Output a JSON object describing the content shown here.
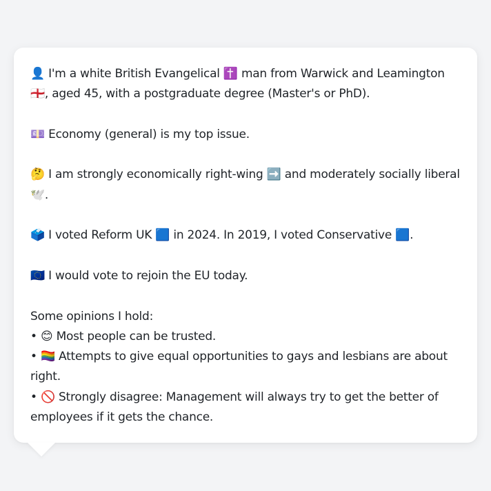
{
  "persona": {
    "intro": {
      "emoji_person": "👤",
      "text_before_religion": "I'm a white British Evangelical",
      "emoji_cross": "✝️",
      "text_before_place": "man from Warwick and Leamington",
      "emoji_flag": "🏴󠁧󠁢󠁥󠁮󠁧󠁿",
      "text_after_place": ", aged 45, with a postgraduate degree (Master's or PhD)."
    },
    "issue": {
      "emoji": "💷",
      "text": "Economy (general) is my top issue."
    },
    "ideology": {
      "emoji_think": "🤔",
      "text_before": "I am strongly economically right-wing",
      "emoji_arrow": "➡️",
      "text_middle": "and moderately socially liberal",
      "emoji_dove": "🕊️",
      "text_end": "."
    },
    "vote": {
      "emoji_ballot": "🗳️",
      "text_2024_before": "I voted Reform UK",
      "emoji_reform": "🟦",
      "text_2024_after": "in 2024. In 2019, I voted Conservative",
      "emoji_con": "🟦",
      "text_end": "."
    },
    "eu": {
      "emoji": "🇪🇺",
      "text": "I would vote to rejoin the EU today."
    },
    "opinions": {
      "heading": "Some opinions I hold:",
      "bullet": "•",
      "items": [
        {
          "emoji": "😊",
          "text": "Most people can be trusted."
        },
        {
          "emoji": "🏳️‍🌈",
          "text": "Attempts to give equal opportunities to gays and lesbians are about right."
        },
        {
          "emoji": "🚫",
          "text": "Strongly disagree: Management will always try to get the better of employees if it gets the chance."
        }
      ]
    }
  },
  "colors": {
    "background": "#f3f4f6",
    "bubble": "#ffffff",
    "text": "#1f2328"
  }
}
